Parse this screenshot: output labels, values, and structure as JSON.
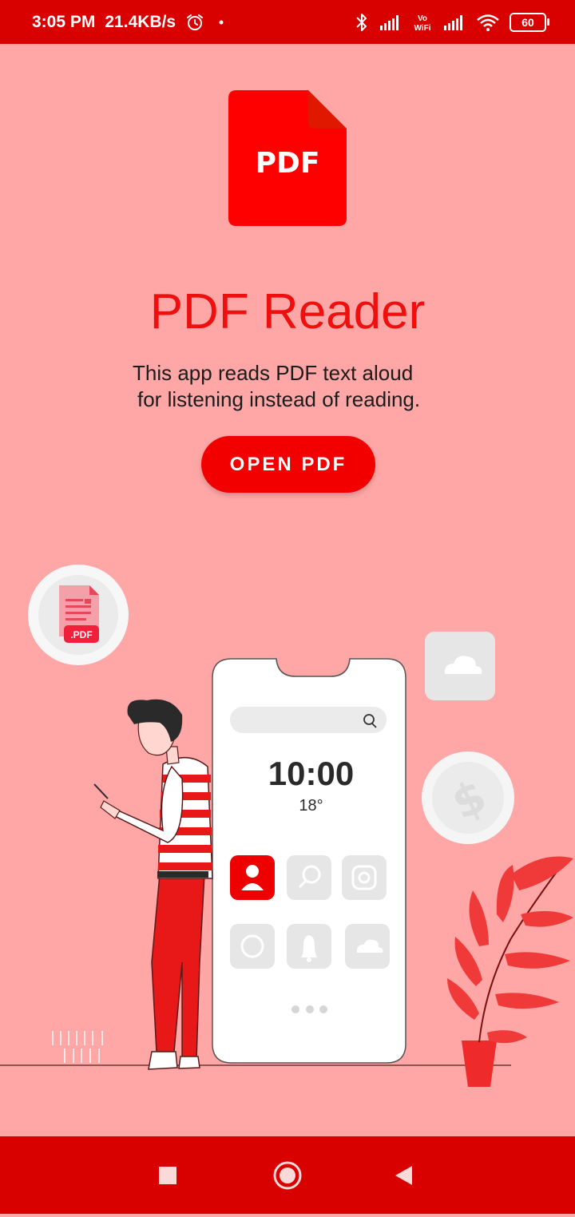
{
  "status_bar": {
    "time": "3:05 PM",
    "speed": "21.4KB/s",
    "battery": "60",
    "icons": [
      "alarm-icon",
      "dot-icon",
      "bluetooth-icon",
      "signal-icon",
      "vowifi-icon",
      "signal-icon",
      "wifi-icon",
      "battery-icon"
    ]
  },
  "app": {
    "logo_text": "PDF",
    "title": "PDF Reader",
    "description_line1": "This app reads PDF text aloud",
    "description_line2": "for listening instead of reading.",
    "open_button": "OPEN PDF"
  },
  "illustration": {
    "pdf_badge": ".PDF",
    "phone_clock": "10:00",
    "phone_temp": "18°",
    "phone_icons": [
      "user-icon",
      "search-icon",
      "instagram-icon",
      "whatsapp-icon",
      "bell-icon",
      "cloud-icon"
    ]
  },
  "nav_bar": {
    "buttons": [
      "recents-button",
      "home-button",
      "back-button"
    ]
  },
  "colors": {
    "status_bar": "#d90000",
    "background": "#ffa6a6",
    "accent": "#f20000",
    "title": "#ee0f0f"
  }
}
